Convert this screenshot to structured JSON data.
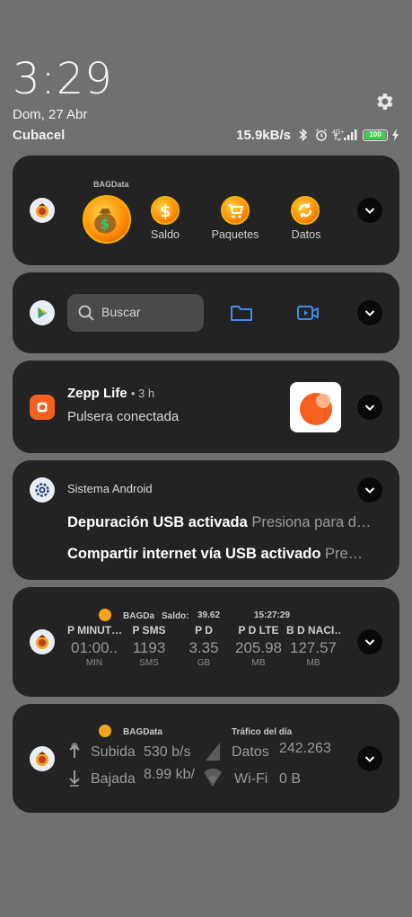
{
  "status": {
    "time": "3:29",
    "date": "Dom, 27 Abr",
    "carrier": "Cubacel",
    "net_speed": "15.9kB/s",
    "network_type": "4G+",
    "battery": "100",
    "icons": [
      "bluetooth-icon",
      "alarm-icon",
      "signal-icon",
      "battery-icon",
      "charging-icon",
      "settings-icon"
    ]
  },
  "cards": {
    "bagdata_shortcuts": {
      "app_name": "BAGData",
      "items": [
        {
          "label": "Saldo",
          "icon": "dollar-coin-icon"
        },
        {
          "label": "Paquetes",
          "icon": "cart-coin-icon"
        },
        {
          "label": "Datos",
          "icon": "sync-coin-icon"
        }
      ]
    },
    "search_widget": {
      "placeholder": "Buscar",
      "icons": [
        "play-store-icon",
        "folder-icon",
        "video-icon"
      ]
    },
    "zepp": {
      "app": "Zepp Life",
      "time": "• 3 h",
      "text": "Pulsera conectada"
    },
    "android_system": {
      "app": "Sistema Android",
      "line1_title": "Depuración USB activada",
      "line1_sub": "Presiona para d…",
      "line2_title": "Compartir internet vía USB activado",
      "line2_sub": "Pre…"
    },
    "bagda_stats": {
      "app": "BAGDa",
      "saldo_label": "Saldo:",
      "saldo_value": "39.62",
      "clock": "15:27:29",
      "columns": [
        {
          "header": "P MINUT…",
          "value": "01:00..",
          "unit": "MIN"
        },
        {
          "header": "P SMS",
          "value": "1193",
          "unit": "SMS"
        },
        {
          "header": "P D",
          "value": "3.35",
          "unit": "GB"
        },
        {
          "header": "P D LTE",
          "value": "205.98",
          "unit": "MB"
        },
        {
          "header": "B D NACI…",
          "value": "127.57",
          "unit": "MB"
        }
      ]
    },
    "traffic": {
      "app": "BAGData",
      "daily_label": "Tráfico del día",
      "upload_label": "Subida",
      "upload_value": "530 b/s",
      "download_label": "Bajada",
      "download_value": "8.99 kb/",
      "data_label": "Datos",
      "data_value": "242.263",
      "wifi_label": "Wi-Fi",
      "wifi_value": "0 B"
    }
  },
  "colors": {
    "background": "#707070",
    "card": "#232323",
    "accent_blue": "#3d8ef0",
    "battery_green": "#3ccf4e",
    "zepp_orange": "#f5601e"
  }
}
